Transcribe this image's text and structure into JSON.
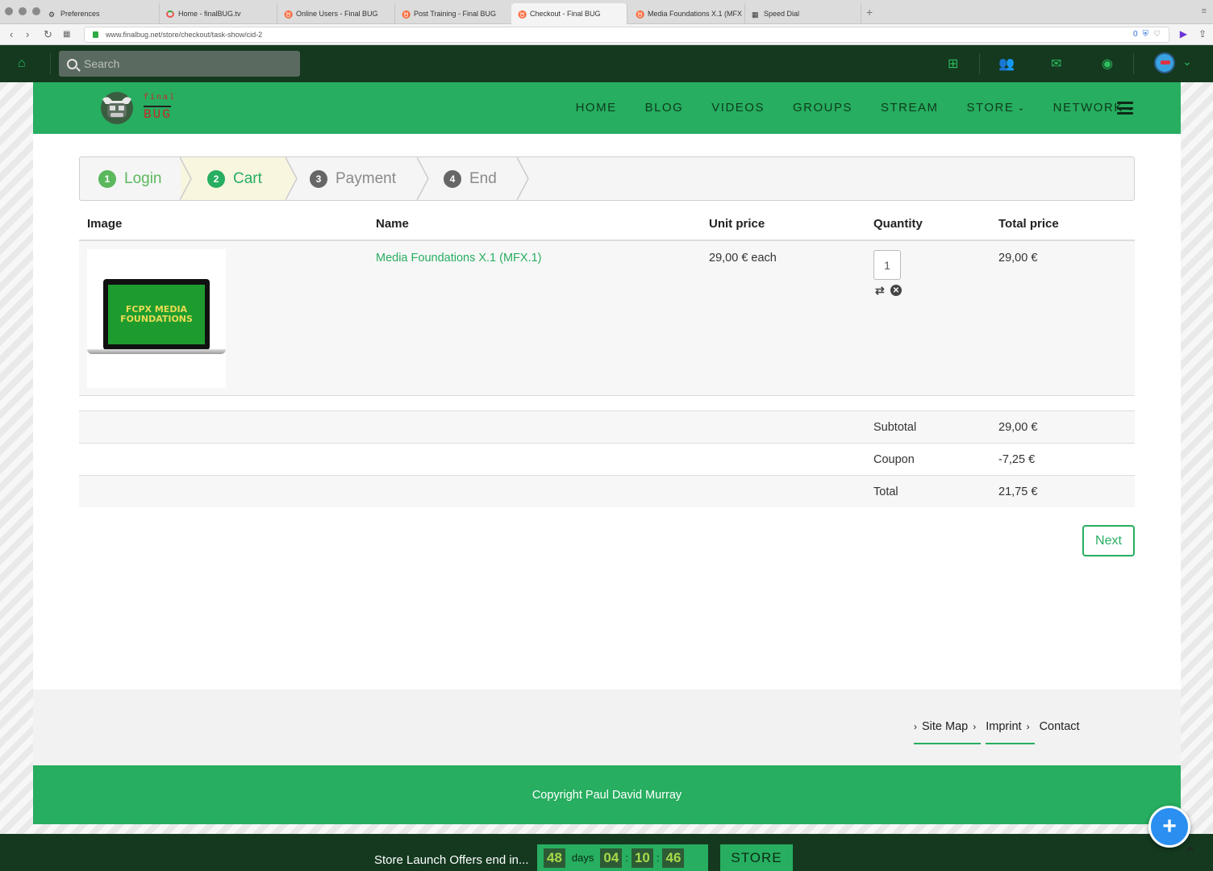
{
  "browser": {
    "tabs": [
      {
        "label": "Preferences",
        "icon": "gear-icon"
      },
      {
        "label": "Home - finalBUG.tv",
        "icon": "spinner-icon"
      },
      {
        "label": "Online Users - Final BUG",
        "icon": "bull-icon"
      },
      {
        "label": "Post Training - Final BUG",
        "icon": "bull-icon"
      },
      {
        "label": "Checkout - Final BUG",
        "icon": "bull-icon"
      },
      {
        "label": "Media Foundations X.1 (MFX",
        "icon": "bull-icon"
      },
      {
        "label": "Speed Dial",
        "icon": "grid-icon"
      }
    ],
    "url": "www.finalbug.net/store/checkout/task-show/cid-2",
    "url_counter": "0"
  },
  "topbar": {
    "search_placeholder": "Search"
  },
  "nav": {
    "items": [
      "HOME",
      "BLOG",
      "VIDEOS",
      "GROUPS",
      "STREAM",
      "STORE",
      "NETWORK"
    ]
  },
  "logo": {
    "top": "final",
    "bottom": "BUG"
  },
  "steps": [
    {
      "num": "1",
      "label": "Login",
      "state": "done"
    },
    {
      "num": "2",
      "label": "Cart",
      "state": "active"
    },
    {
      "num": "3",
      "label": "Payment",
      "state": "todo"
    },
    {
      "num": "4",
      "label": "End",
      "state": "todo"
    }
  ],
  "table": {
    "headers": [
      "Image",
      "Name",
      "Unit price",
      "Quantity",
      "Total price"
    ],
    "item": {
      "image_text": "FCPX MEDIA FOUNDATIONS",
      "name": "Media Foundations X.1 (MFX.1)",
      "unit_price": "29,00 € each",
      "quantity": "1",
      "total": "29,00 €"
    }
  },
  "summary": [
    {
      "label": "Subtotal",
      "value": "29,00 €"
    },
    {
      "label": "Coupon",
      "value": "-7,25 €"
    },
    {
      "label": "Total",
      "value": "21,75 €"
    }
  ],
  "next_label": "Next",
  "footer": {
    "links": [
      "Site Map",
      "Imprint",
      "Contact"
    ],
    "copyright": "Copyright Paul David Murray"
  },
  "offer": {
    "text": "Store Launch Offers end in...",
    "days": "48",
    "days_label": "days",
    "hours": "04",
    "minutes": "10",
    "seconds": "46",
    "store_label": "STORE"
  },
  "colors": {
    "brand_green": "#27ae60",
    "dark_green": "#14391f",
    "fab_blue": "#2a8ff0"
  }
}
